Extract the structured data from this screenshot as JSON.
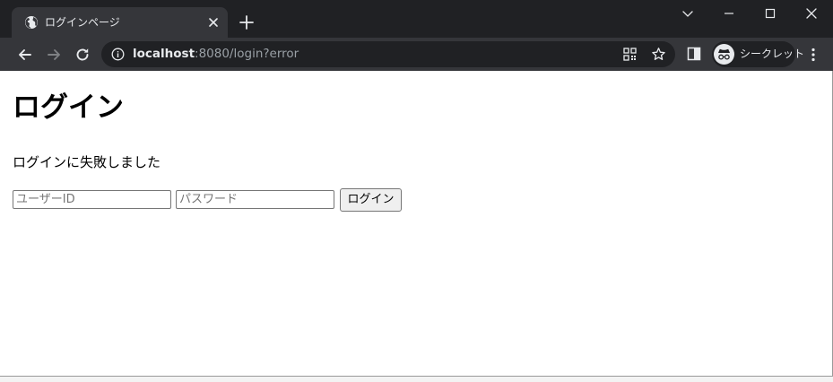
{
  "browser": {
    "tab": {
      "title": "ログインページ"
    },
    "address_bar": {
      "host": "localhost",
      "rest": ":8080/login?error"
    },
    "incognito_label": "シークレット"
  },
  "page": {
    "heading": "ログイン",
    "error_message": "ログインに失敗しました",
    "form": {
      "username_placeholder": "ユーザーID",
      "username_value": "",
      "password_placeholder": "パスワード",
      "password_value": "",
      "submit_label": "ログイン"
    }
  },
  "colors": {
    "tabstrip_bg": "#202124",
    "toolbar_bg": "#35363a",
    "omnibox_bg": "#202124",
    "text_light": "#e8eaed",
    "text_dim": "#9aa0a6"
  }
}
